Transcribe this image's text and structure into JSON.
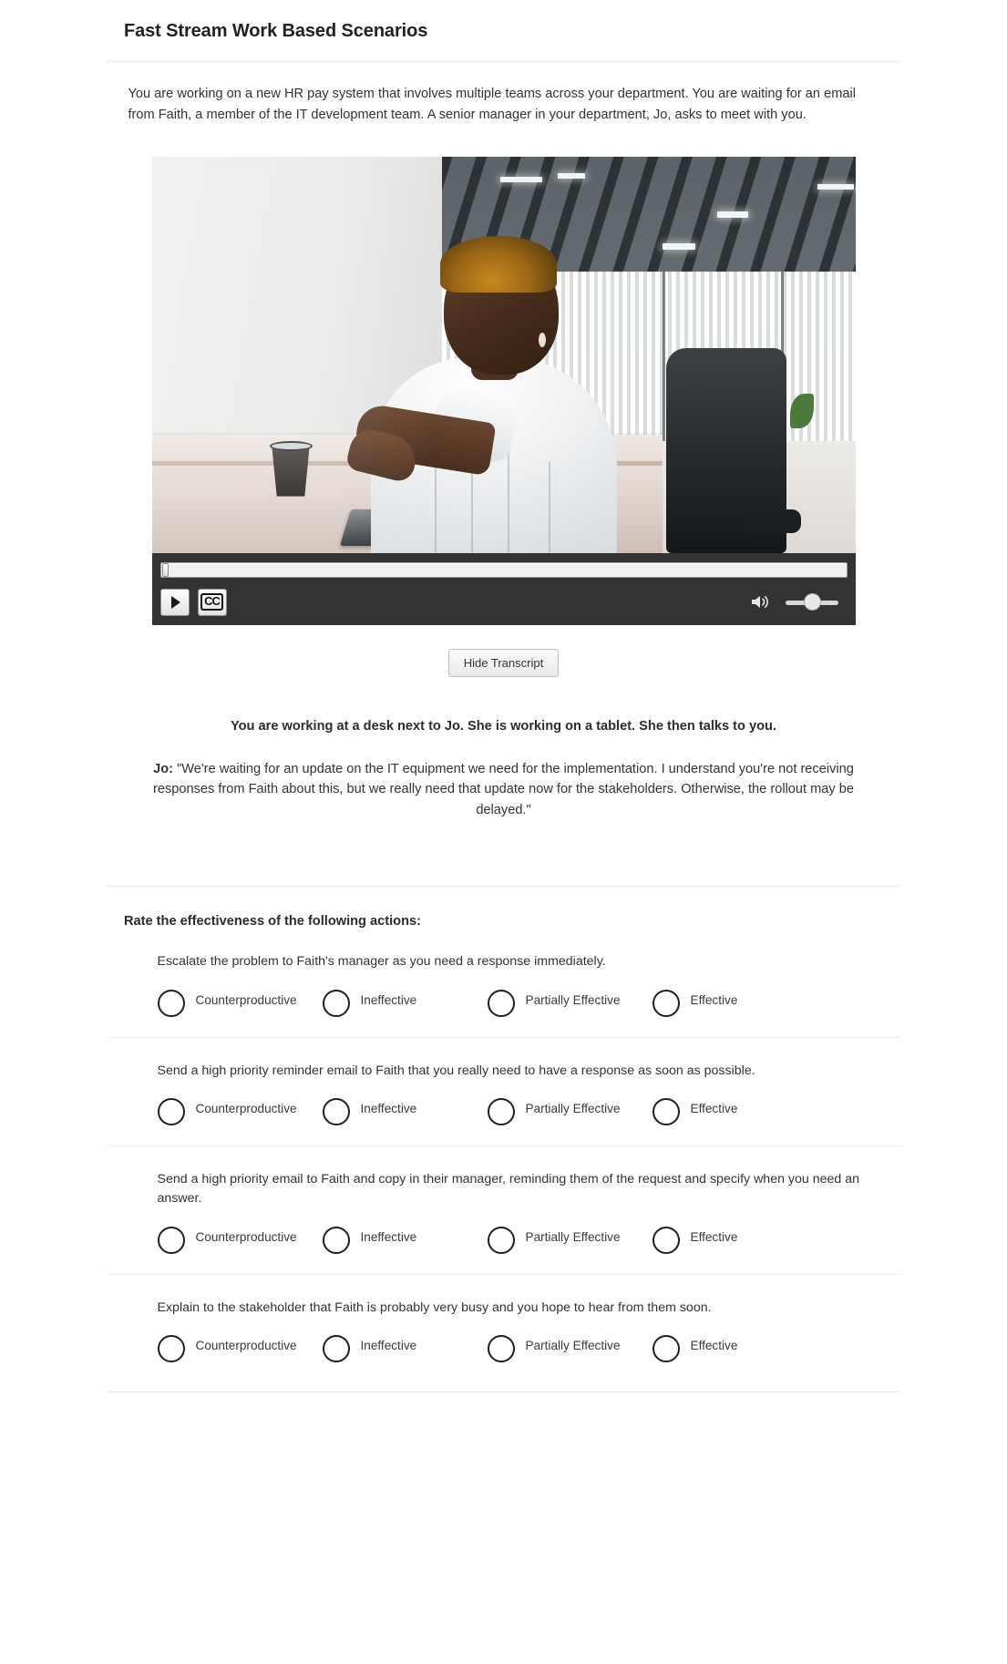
{
  "header": {
    "title": "Fast Stream Work Based Scenarios"
  },
  "scenario": {
    "stem": "You are working on a new HR pay system that involves multiple teams across your department. You are waiting for an email from Faith, a member of the IT development team. A senior manager in your department, Jo, asks to meet with you."
  },
  "video": {
    "play_label": "Play",
    "cc_label": "CC",
    "seek_position_percent": 0,
    "volume_percent": 50,
    "transcript_toggle_label": "Hide Transcript"
  },
  "transcript": {
    "scene_description": "You are working at a desk next to Jo. She is working on a tablet. She then talks to you.",
    "speaker": "Jo:",
    "dialogue": "\"We're waiting for an update on the IT equipment we need for the implementation. I understand you're not receiving responses from Faith about this, but we really need that update now for the stakeholders. Otherwise, the rollout may be delayed.\""
  },
  "rating": {
    "heading": "Rate the effectiveness of the following actions:",
    "scale": [
      "Counterproductive",
      "Ineffective",
      "Partially Effective",
      "Effective"
    ],
    "items": [
      {
        "text": "Escalate the problem to Faith's manager as you need a response immediately."
      },
      {
        "text": "Send a high priority reminder email to Faith that you really need to have a response as soon as possible."
      },
      {
        "text": "Send a high priority email to Faith and copy in their manager, reminding them of the request and specify when you need an answer."
      },
      {
        "text": "Explain to the stakeholder that Faith is probably very busy and you hope to hear from them soon."
      }
    ]
  }
}
